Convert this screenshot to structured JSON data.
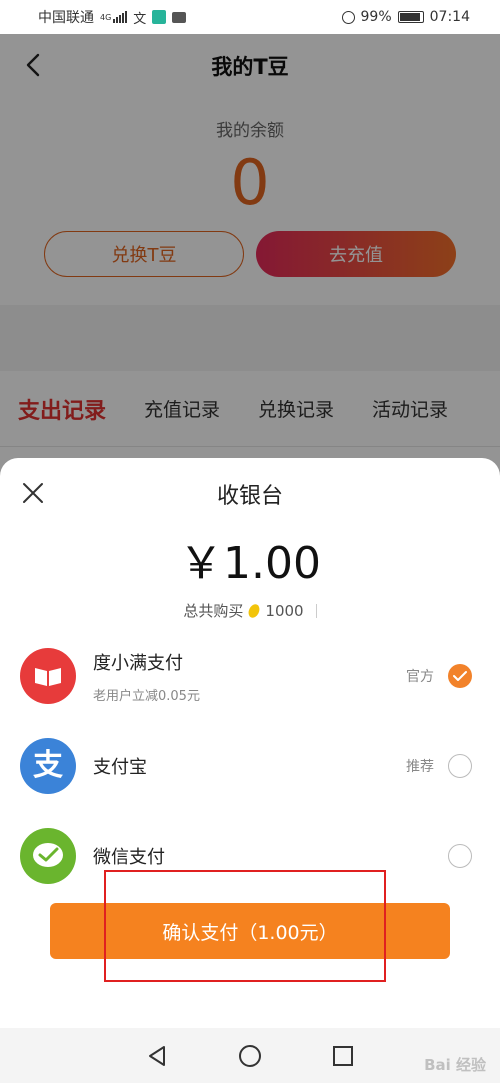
{
  "status_bar": {
    "carrier": "中国联通",
    "network": "4G",
    "battery": "99%",
    "time": "07:14"
  },
  "header": {
    "title": "我的T豆"
  },
  "balance": {
    "label": "我的余额",
    "value": "0"
  },
  "actions": {
    "exchange_label": "兑换T豆",
    "recharge_label": "去充值"
  },
  "tabs": [
    {
      "label": "支出记录",
      "active": true
    },
    {
      "label": "充值记录",
      "active": false
    },
    {
      "label": "兑换记录",
      "active": false
    },
    {
      "label": "活动记录",
      "active": false
    }
  ],
  "checkout": {
    "title": "收银台",
    "amount": "￥1.00",
    "purchase_label": "总共购买",
    "purchase_count": "1000",
    "methods": [
      {
        "name": "度小满支付",
        "sub": "老用户立减0.05元",
        "tag": "官方",
        "selected": true,
        "icon": "du-xiaoman-icon",
        "color": "#e73b3b"
      },
      {
        "name": "支付宝",
        "sub": "",
        "tag": "推荐",
        "selected": false,
        "icon": "alipay-icon",
        "color": "#3b83d8"
      },
      {
        "name": "微信支付",
        "sub": "",
        "tag": "",
        "selected": false,
        "icon": "wechat-pay-icon",
        "color": "#6ab52e"
      }
    ],
    "confirm_label": "确认支付（1.00元）"
  },
  "watermark": "Bai 经验",
  "colors": {
    "accent": "#e0641f",
    "active_tab": "#e0312f",
    "pay_button": "#f5821f",
    "highlight_box": "#e02020"
  }
}
